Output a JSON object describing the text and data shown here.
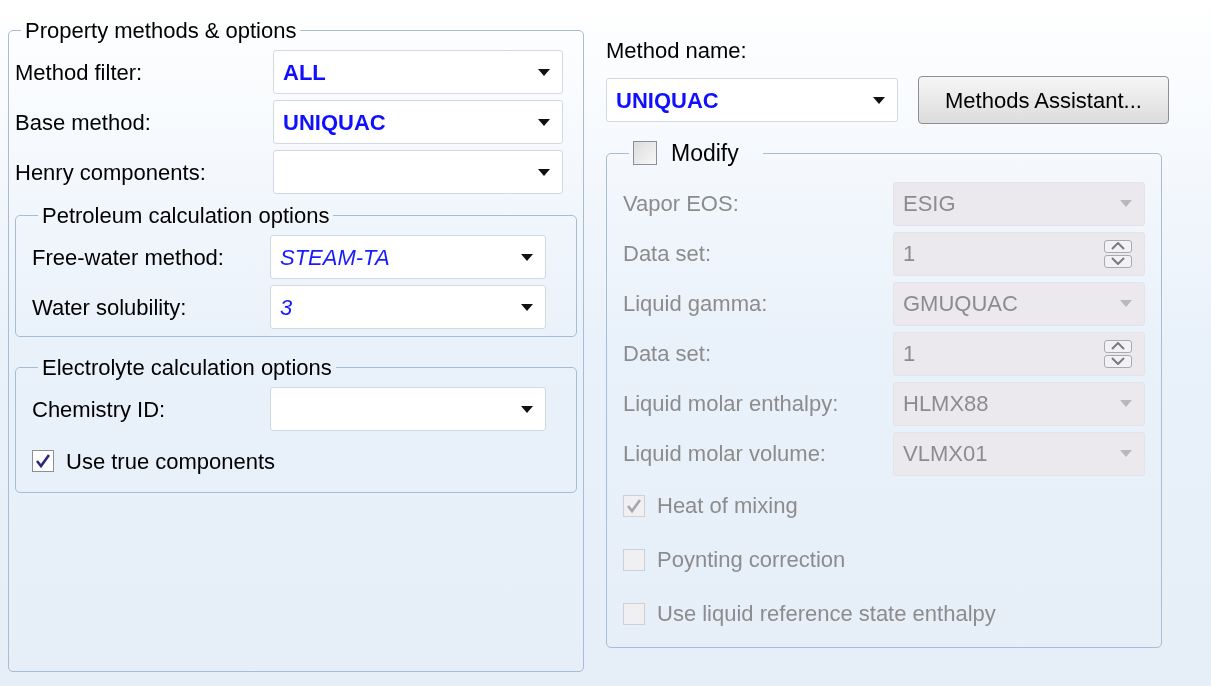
{
  "property_methods": {
    "title": "Property methods & options",
    "fields": [
      {
        "label": "Method filter:",
        "value": "ALL",
        "kind": "entered"
      },
      {
        "label": "Base method:",
        "value": "UNIQUAC",
        "kind": "entered"
      },
      {
        "label": "Henry components:"
      }
    ],
    "petroleum": {
      "title": "Petroleum calculation options",
      "fields": [
        {
          "label": "Free-water method:",
          "value": "STEAM-TA",
          "kind": "default"
        },
        {
          "label": "Water solubility:",
          "value": "3",
          "kind": "default"
        }
      ]
    },
    "electrolyte": {
      "title": "Electrolyte calculation options",
      "fields": [
        {
          "label": "Chemistry ID:"
        }
      ],
      "checkboxes": [
        {
          "label": "Use true components",
          "checked": true,
          "disabled": false
        }
      ]
    }
  },
  "method_name": {
    "label": "Method name:",
    "value": "UNIQUAC",
    "kind": "entered"
  },
  "assistant_button": "Methods Assistant...",
  "modify": {
    "label": "Modify",
    "checked": false,
    "fields": [
      {
        "label": "Vapor EOS:",
        "value": "ESIG",
        "kind": "dropdown",
        "disabled": true
      },
      {
        "label": "Data set:",
        "value": "1",
        "kind": "spinner",
        "disabled": true
      },
      {
        "label": "Liquid gamma:",
        "value": "GMUQUAC",
        "kind": "dropdown",
        "disabled": true
      },
      {
        "label": "Data set:",
        "value": "1",
        "kind": "spinner",
        "disabled": true
      },
      {
        "label": "Liquid molar enthalpy:",
        "value": "HLMX88",
        "kind": "dropdown",
        "disabled": true
      },
      {
        "label": "Liquid molar volume:",
        "value": "VLMX01",
        "kind": "dropdown",
        "disabled": true
      }
    ],
    "checkboxes": [
      {
        "label": "Heat of mixing",
        "checked": true,
        "disabled": true
      },
      {
        "label": "Poynting correction",
        "checked": false,
        "disabled": true
      },
      {
        "label": "Use liquid reference state enthalpy",
        "checked": false,
        "disabled": true
      }
    ]
  }
}
